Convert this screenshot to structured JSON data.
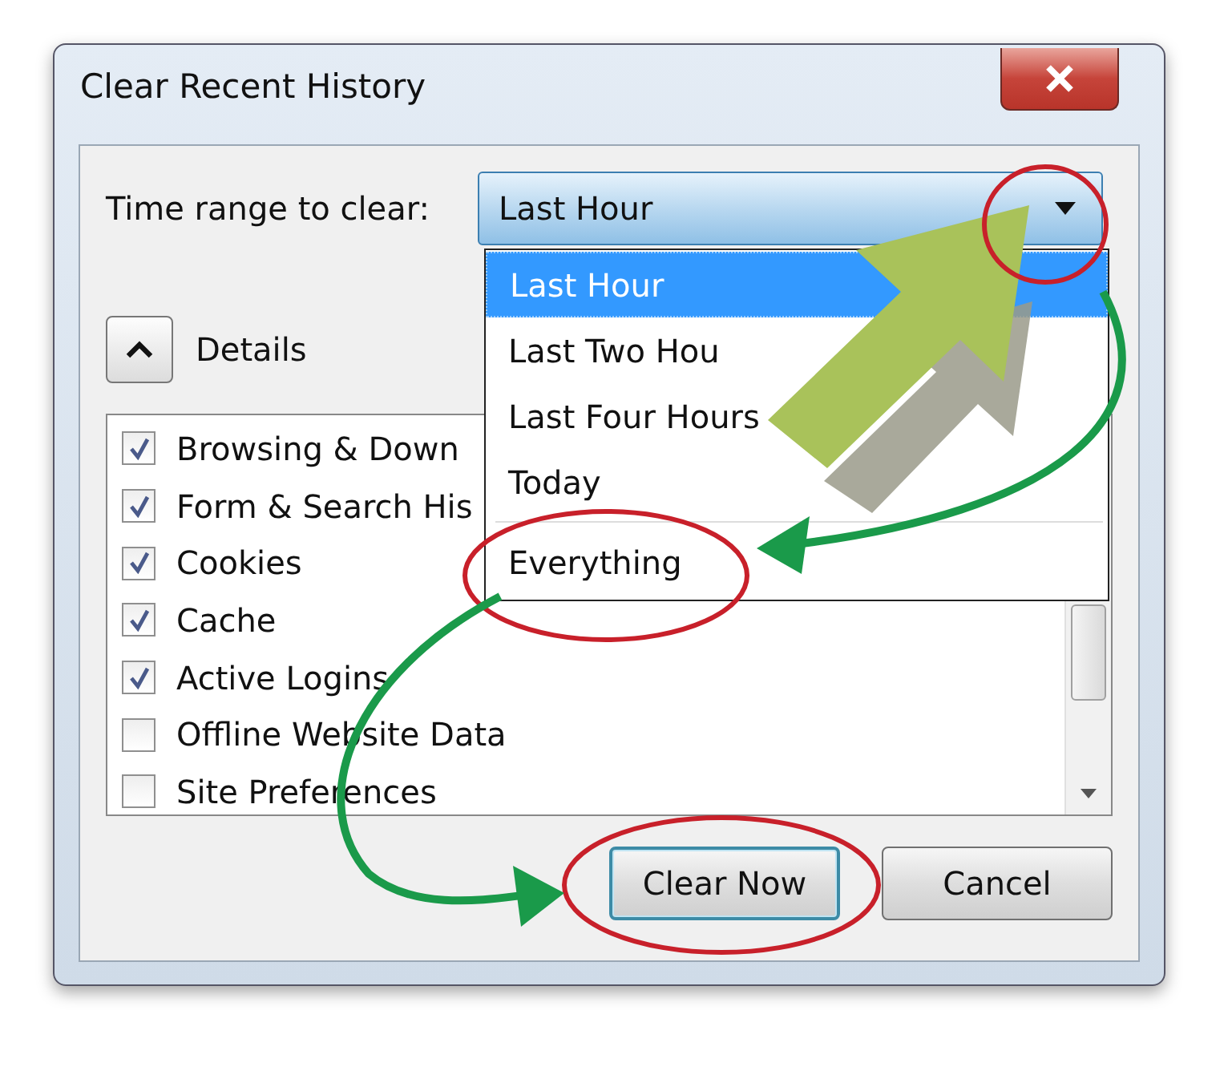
{
  "window": {
    "title": "Clear Recent History"
  },
  "time_range": {
    "label": "Time range to clear:",
    "value": "Last Hour",
    "expanded": true
  },
  "dropdown_options": [
    {
      "label": "Last Hour",
      "selected": true,
      "divider_above": false
    },
    {
      "label": "Last Two Hou",
      "selected": false,
      "divider_above": false
    },
    {
      "label": "Last Four Hours",
      "selected": false,
      "divider_above": false
    },
    {
      "label": "Today",
      "selected": false,
      "divider_above": false
    },
    {
      "label": "Everything",
      "selected": false,
      "divider_above": true
    }
  ],
  "details": {
    "label": "Details",
    "expanded": true
  },
  "items": [
    {
      "label": "Browsing & Down",
      "checked": true
    },
    {
      "label": "Form & Search His",
      "checked": true
    },
    {
      "label": "Cookies",
      "checked": true
    },
    {
      "label": "Cache",
      "checked": true
    },
    {
      "label": "Active Logins",
      "checked": true
    },
    {
      "label": "Offline Website Data",
      "checked": false
    },
    {
      "label": "Site Preferences",
      "checked": false
    }
  ],
  "buttons": [
    {
      "label": "Clear Now",
      "default": true
    },
    {
      "label": "Cancel",
      "default": false
    }
  ]
}
